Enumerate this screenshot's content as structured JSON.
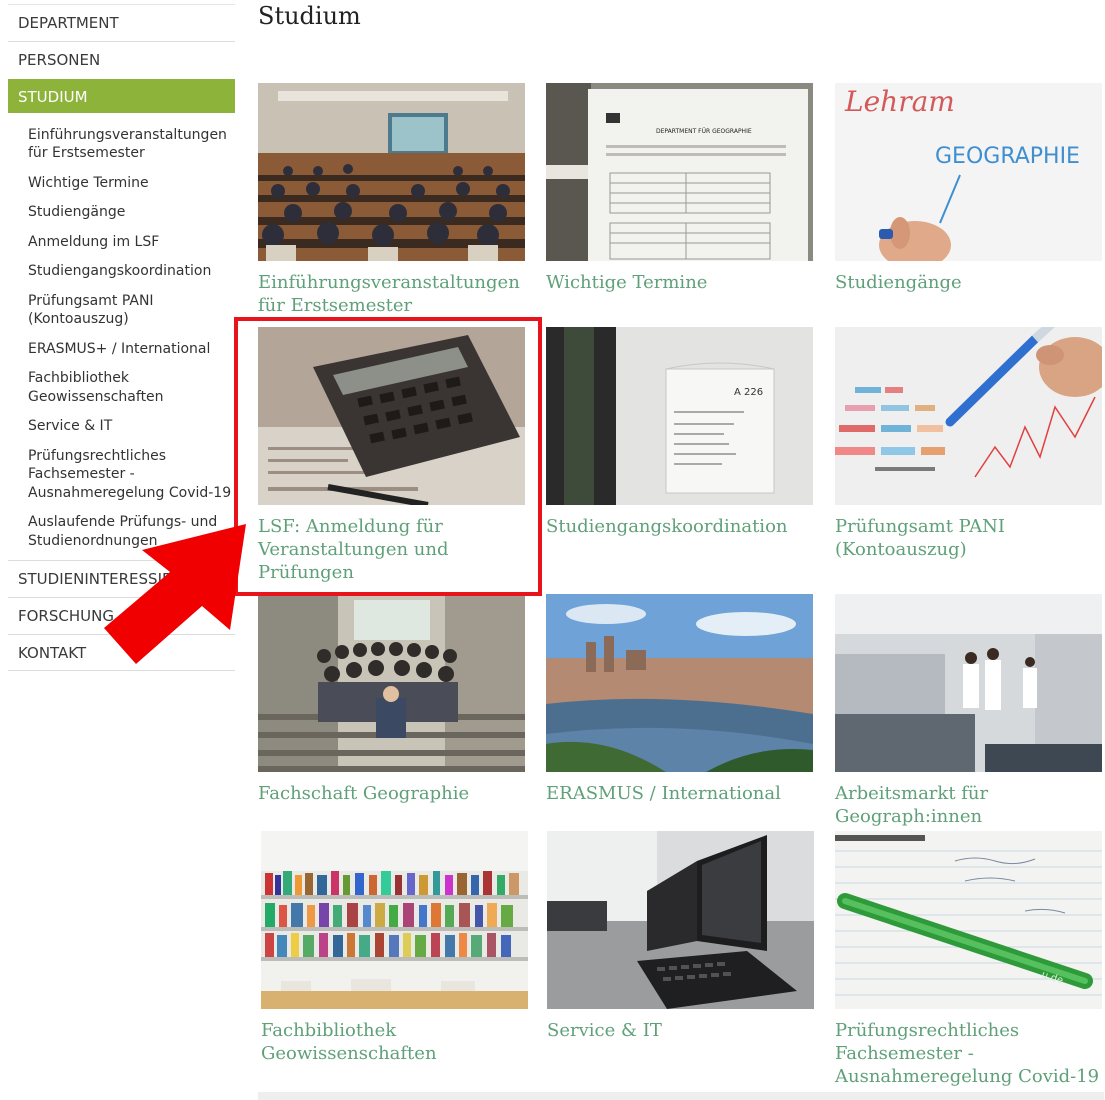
{
  "page": {
    "title": "Studium"
  },
  "sidebar": {
    "top_items": [
      {
        "label": "DEPARTMENT"
      },
      {
        "label": "PERSONEN"
      },
      {
        "label": "STUDIUM"
      }
    ],
    "sub_items": [
      {
        "label": "Einführungsveranstaltungen für Erstsemester"
      },
      {
        "label": "Wichtige Termine"
      },
      {
        "label": "Studiengänge"
      },
      {
        "label": "Anmeldung im LSF"
      },
      {
        "label": "Studiengangskoordination"
      },
      {
        "label": "Prüfungsamt PANI (Kontoauszug)"
      },
      {
        "label": "ERASMUS+ / International"
      },
      {
        "label": "Fachbibliothek Geowissenschaften"
      },
      {
        "label": "Service & IT"
      },
      {
        "label": "Prüfungsrechtliches Fachsemester - Ausnahmeregelung Covid-19"
      },
      {
        "label": "Auslaufende Prüfungs- und Studienordnungen"
      }
    ],
    "bottom_items": [
      {
        "label": "STUDIENINTERESSIERTE"
      },
      {
        "label": "FORSCHUNG"
      },
      {
        "label": "KONTAKT"
      }
    ]
  },
  "tiles": [
    {
      "caption": "Einführungsveranstaltungen für Erstsemester"
    },
    {
      "caption": "Wichtige Termine"
    },
    {
      "caption": "Studiengänge"
    },
    {
      "caption": "LSF: Anmeldung für Veranstaltungen und Prüfungen"
    },
    {
      "caption": "Studiengangskoordination"
    },
    {
      "caption": "Prüfungsamt PANI (Kontoauszug)"
    },
    {
      "caption": "Fachschaft Geographie"
    },
    {
      "caption": "ERASMUS / International"
    },
    {
      "caption": "Arbeitsmarkt für Geograph:innen"
    },
    {
      "caption": "Fachbibliothek Geowissenschaften"
    },
    {
      "caption": "Service & IT"
    },
    {
      "caption": "Prüfungsrechtliches Fachsemester - Ausnahmeregelung Covid-19"
    }
  ],
  "image_text": {
    "whiteboard_word": "GEOGRAPHIE",
    "whiteboard_top": "Lehram",
    "room_sign": "A 226",
    "poster_header": "DEPARTMENT FÜR GEOGRAPHIE",
    "pen_brand": "u.de"
  },
  "colors": {
    "accent_green": "#8db33a",
    "caption_green": "#5fa079",
    "highlight_red": "#e8141b"
  }
}
